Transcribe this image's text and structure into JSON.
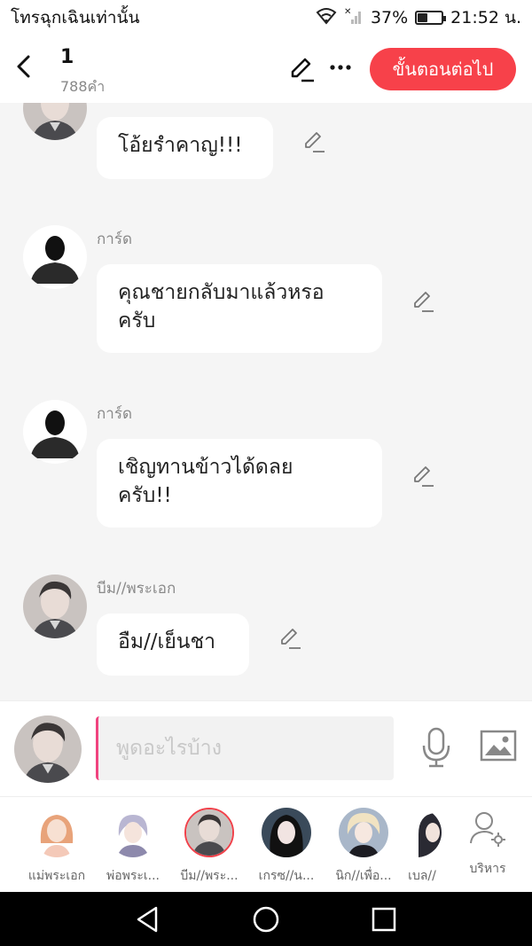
{
  "status_bar": {
    "carrier_text": "โทรฉุกเฉินเท่านั้น",
    "battery_percent": "37%",
    "battery_level": 0.37,
    "time": "21:52 น.",
    "icons": [
      "wifi-icon",
      "no-signal-icon",
      "battery-icon"
    ]
  },
  "header": {
    "title": "1",
    "word_count": "788คำ",
    "next_button_label": "ขั้นตอนต่อไป",
    "icons": [
      "back-chevron-icon",
      "edit-pencil-icon",
      "more-dots-icon"
    ]
  },
  "messages": [
    {
      "sender": "",
      "text": "โอ้ยรำคาญ!!!",
      "avatar": "man-portrait"
    },
    {
      "sender": "การ์ด",
      "text_lines": [
        "คุณชายกลับมาแล้วหรอ",
        "ครับ"
      ],
      "avatar": "silhouette"
    },
    {
      "sender": "การ์ด",
      "text_lines": [
        "เชิญทานข้าวได้ดลย",
        "ครับ!!"
      ],
      "avatar": "silhouette"
    },
    {
      "sender": "บีม//พระเอก",
      "text": "อืม//เย็นชา",
      "avatar": "man-portrait"
    }
  ],
  "input": {
    "placeholder": "พูดอะไรบ้าง",
    "icons": [
      "microphone-icon",
      "image-icon"
    ]
  },
  "characters": [
    {
      "name": "แม่พระเอก",
      "selected": false
    },
    {
      "name": "พ่อพระเ...",
      "selected": false
    },
    {
      "name": "บีม//พระ...",
      "selected": true
    },
    {
      "name": "เกรซ//น...",
      "selected": false
    },
    {
      "name": "นิก//เพื่อ...",
      "selected": false
    },
    {
      "name": "เบล//",
      "selected": false
    }
  ],
  "manage_label": "บริหาร",
  "colors": {
    "accent": "#f7414a",
    "cursor": "#f0437f"
  }
}
